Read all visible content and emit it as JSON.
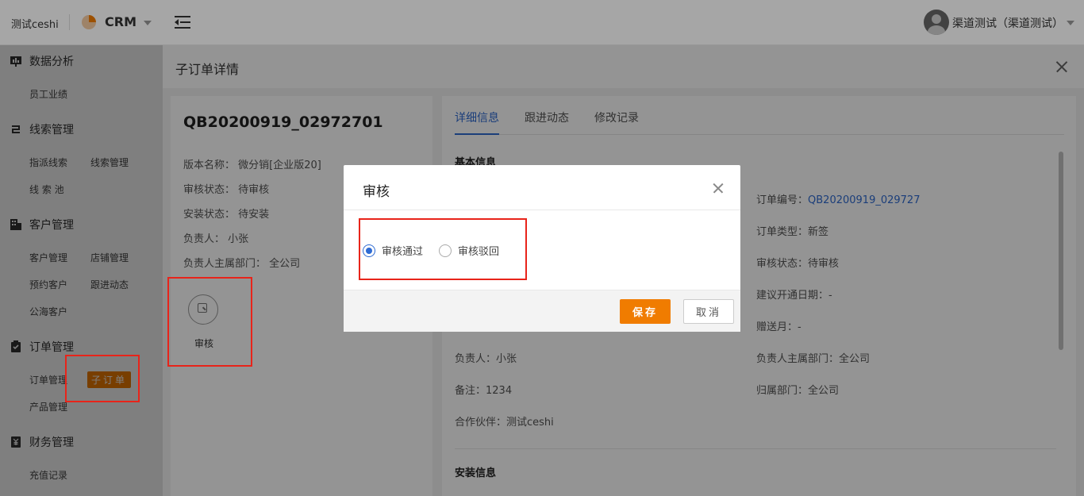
{
  "header": {
    "tenant": "测试ceshi",
    "app_name": "CRM",
    "user": "渠道测试（渠道测试）"
  },
  "sidebar": {
    "groups": [
      {
        "title": "数据分析",
        "icon": "chart-board-icon",
        "items": [
          "员工业绩"
        ]
      },
      {
        "title": "线索管理",
        "icon": "link-icon",
        "items": [
          "指派线索",
          "线索管理",
          "线 索 池"
        ]
      },
      {
        "title": "客户管理",
        "icon": "building-icon",
        "items": [
          "客户管理",
          "店铺管理",
          "预约客户",
          "跟进动态",
          "公海客户"
        ]
      },
      {
        "title": "订单管理",
        "icon": "clipboard-check-icon",
        "items": [
          "订单管理",
          "子订单",
          "产品管理"
        ]
      },
      {
        "title": "财务管理",
        "icon": "ledger-icon",
        "items": [
          "充值记录"
        ]
      }
    ],
    "active_item": "子订单"
  },
  "drawer": {
    "title": "子订单详情",
    "order_no": "QB20200919_02972701",
    "info": [
      "版本名称： 微分销[企业版20]",
      "审核状态： 待审核",
      "安装状态： 待安装",
      "负责人： 小张",
      "负责人主属部门： 全公司"
    ],
    "action_label": "审核",
    "tabs": [
      "详细信息",
      "跟进动态",
      "修改记录"
    ],
    "active_tab": "详细信息",
    "section_basic": "基本信息",
    "section_install": "安装信息",
    "fields_right": [
      {
        "label": "订单编号：",
        "value": "QB20200919_029727"
      },
      {
        "label": "订单类型：",
        "value": "新签"
      },
      {
        "label": "审核状态：",
        "value": "待审核"
      },
      {
        "label": "建议开通日期：",
        "value": "-"
      },
      {
        "label": "赠送月：",
        "value": "-"
      },
      {
        "label": "负责人主属部门：",
        "value": "全公司"
      },
      {
        "label": "归属部门：",
        "value": "全公司"
      }
    ],
    "fields_left": [
      {
        "label": "负责人：",
        "value": "小张"
      },
      {
        "label": "备注：",
        "value": "1234"
      },
      {
        "label": "合作伙伴：",
        "value": "测试ceshi"
      }
    ]
  },
  "modal": {
    "title": "审核",
    "options": [
      "审核通过",
      "审核驳回"
    ],
    "selected": "审核通过",
    "save_label": "保存",
    "cancel_label": "取消"
  },
  "colors": {
    "accent": "#f07c00",
    "link": "#2f6bd3",
    "highlight": "#e8241a"
  }
}
